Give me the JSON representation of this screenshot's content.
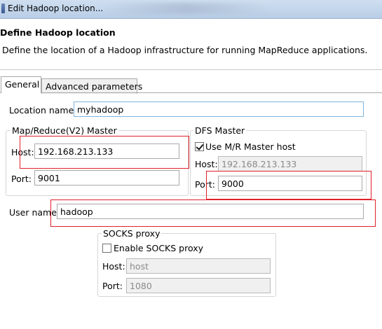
{
  "window": {
    "title": "Edit Hadoop location..."
  },
  "header": {
    "title": "Define Hadoop location",
    "description": "Define the location of a Hadoop infrastructure for running MapReduce applications."
  },
  "tabs": [
    {
      "label": "General",
      "selected": true
    },
    {
      "label": "Advanced parameters",
      "selected": false
    }
  ],
  "general": {
    "location_name_label": "Location name:",
    "location_name_value": "myhadoop",
    "mapreduce_master": {
      "title": "Map/Reduce(V2) Master",
      "host_label": "Host:",
      "host_value": "192.168.213.133",
      "port_label": "Port:",
      "port_value": "9001"
    },
    "dfs_master": {
      "title": "DFS Master",
      "use_mr_host_label": "Use M/R Master host",
      "use_mr_host_checked": true,
      "host_label": "Host:",
      "host_value": "192.168.213.133",
      "port_label": "Port:",
      "port_value": "9000"
    },
    "user_name_label": "User name:",
    "user_name_value": "hadoop",
    "socks_proxy": {
      "title": "SOCKS proxy",
      "enable_label": "Enable SOCKS proxy",
      "enable_checked": false,
      "host_label": "Host:",
      "host_value": "host",
      "port_label": "Port:",
      "port_value": "1080"
    }
  },
  "colors": {
    "highlight_box": "#e0202a",
    "focus_border": "#7fb4dc"
  },
  "icons": {
    "window_icon": "app-icon"
  }
}
